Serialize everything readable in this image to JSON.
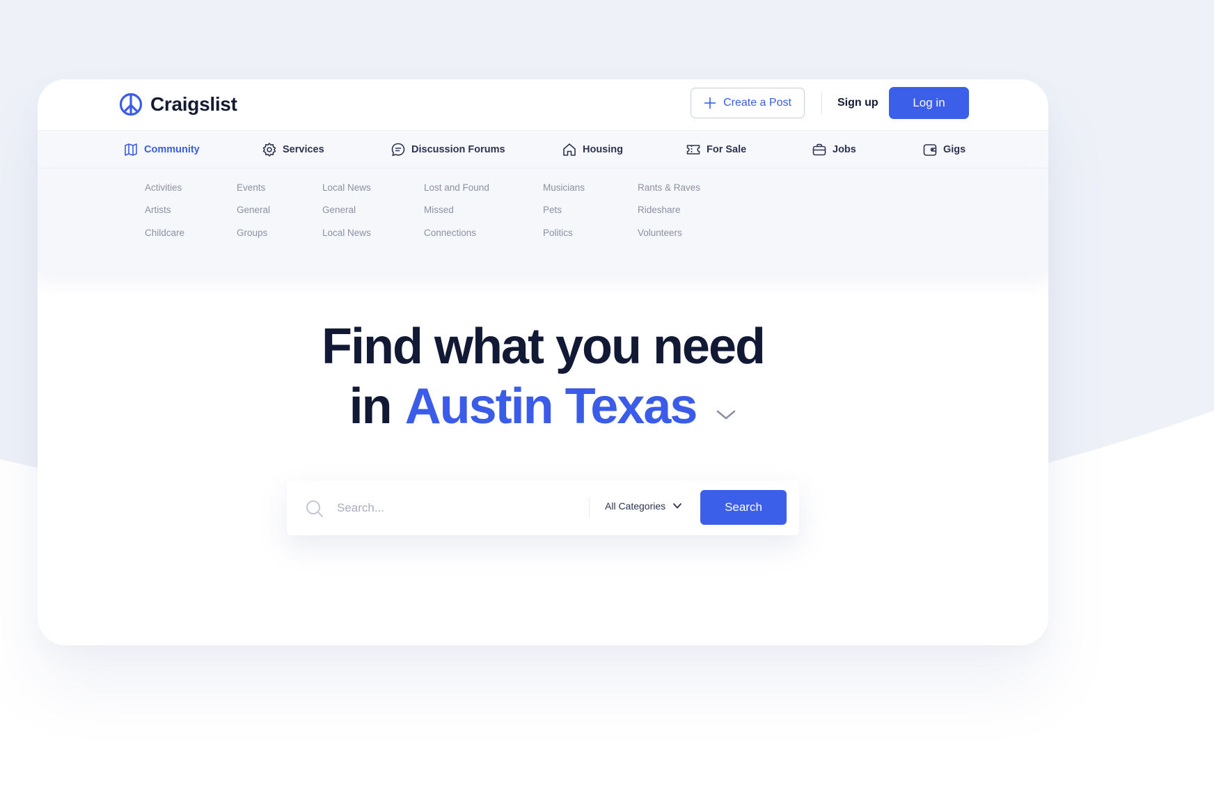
{
  "brand": {
    "name": "Craigslist",
    "accent_color": "#3b5fe9",
    "logo_icon": "peace-icon"
  },
  "header": {
    "create_post_label": "Create a Post",
    "signup_label": "Sign up",
    "login_label": "Log in"
  },
  "nav": {
    "items": [
      {
        "label": "Community",
        "icon": "map-icon",
        "active": true
      },
      {
        "label": "Services",
        "icon": "gear-icon",
        "active": false
      },
      {
        "label": "Discussion Forums",
        "icon": "chat-icon",
        "active": false
      },
      {
        "label": "Housing",
        "icon": "home-icon",
        "active": false
      },
      {
        "label": "For Sale",
        "icon": "ticket-icon",
        "active": false
      },
      {
        "label": "Jobs",
        "icon": "briefcase-icon",
        "active": false
      },
      {
        "label": "Gigs",
        "icon": "wallet-icon",
        "active": false
      }
    ]
  },
  "dropdown": {
    "columns": [
      [
        "Activities",
        "Artists",
        "Childcare"
      ],
      [
        "Events",
        "General",
        "Groups"
      ],
      [
        "Local News",
        "General",
        "Local News"
      ],
      [
        "Lost and Found",
        "Missed",
        "Connections"
      ],
      [
        "Musicians",
        "Pets",
        "Politics"
      ],
      [
        "Rants & Raves",
        "Rideshare",
        "Volunteers"
      ]
    ]
  },
  "hero": {
    "line1": "Find what you need",
    "prefix": "in",
    "city": "Austin Texas"
  },
  "search": {
    "placeholder": "Search...",
    "category_label": "All Categories",
    "button_label": "Search"
  }
}
